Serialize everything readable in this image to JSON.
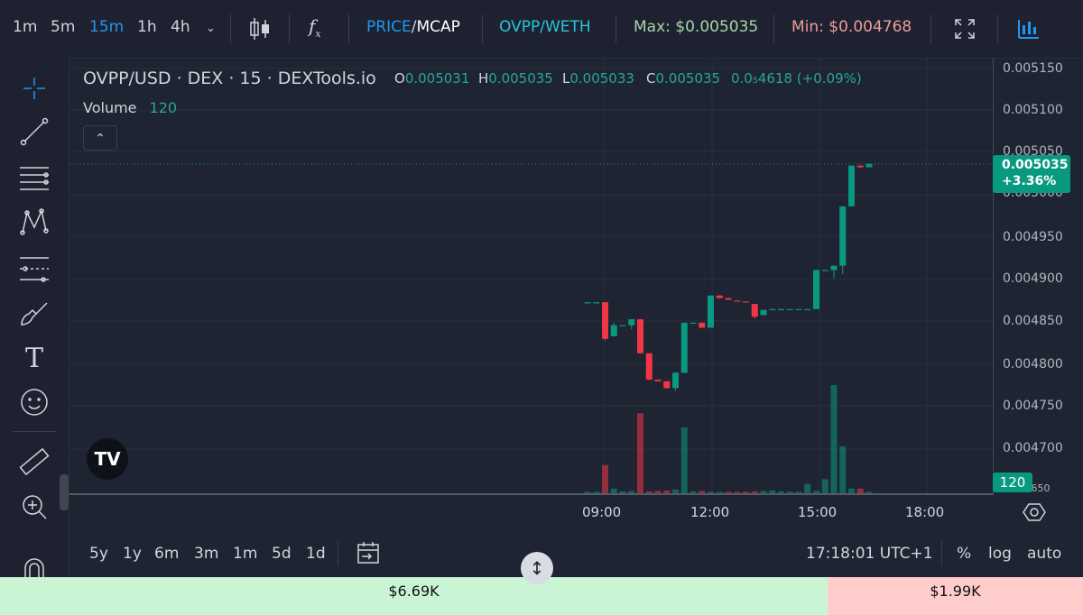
{
  "toolbar": {
    "intervals": [
      "1m",
      "5m",
      "15m",
      "1h",
      "4h"
    ],
    "active_interval": "15m",
    "price_mcap": {
      "first": "PRICE",
      "sep": "/",
      "second": "MCAP"
    },
    "pair": "OVPP/WETH",
    "max_label": "Max: $0.005035",
    "min_label": "Min: $0.004768"
  },
  "legend": {
    "title": "OVPP/USD · DEX · 15 · DEXTools.io",
    "open_key": "O",
    "open": "0.005031",
    "high_key": "H",
    "high": "0.005035",
    "low_key": "L",
    "low": "0.005033",
    "close_key": "C",
    "close": "0.005035",
    "change": "0.0₅4618 (+0.09%)",
    "volume_label": "Volume",
    "volume_value": "120"
  },
  "price_axis": [
    "0.005150",
    "0.005100",
    "0.005050",
    "0.005000",
    "0.004950",
    "0.004900",
    "0.004850",
    "0.004800",
    "0.004750",
    "0.004700",
    "0.004650"
  ],
  "current_price": {
    "price": "0.005035",
    "change": "+3.36%"
  },
  "volume_tag": "120",
  "time_axis": [
    "09:00",
    "12:00",
    "15:00",
    "18:00"
  ],
  "bottom": {
    "ranges": [
      "5y",
      "1y",
      "6m",
      "3m",
      "1m",
      "5d",
      "1d"
    ],
    "clock": "17:18:01 UTC+1",
    "percent": "%",
    "log": "log",
    "auto": "auto"
  },
  "buy_total": "$6.69K",
  "sell_total": "$1.99K",
  "logo_text": "TV",
  "colors": {
    "up": "#089981",
    "down": "#f23645",
    "accent": "#2196f3",
    "max": "#a5d6a7",
    "min": "#ef9a9a"
  },
  "chart_data": {
    "type": "candlestick",
    "interval": "15m",
    "candles": [
      {
        "t": "08:15",
        "o": 0.004872,
        "h": 0.004872,
        "l": 0.004872,
        "c": 0.004872
      },
      {
        "t": "08:30",
        "o": 0.004872,
        "h": 0.004872,
        "l": 0.004872,
        "c": 0.004872
      },
      {
        "t": "08:45",
        "o": 0.004872,
        "h": 0.004872,
        "l": 0.004827,
        "c": 0.004829
      },
      {
        "t": "09:00",
        "o": 0.004832,
        "h": 0.004848,
        "l": 0.004832,
        "c": 0.004845
      },
      {
        "t": "09:15",
        "o": 0.004845,
        "h": 0.004845,
        "l": 0.004845,
        "c": 0.004845
      },
      {
        "t": "09:30",
        "o": 0.004845,
        "h": 0.004852,
        "l": 0.00484,
        "c": 0.004852
      },
      {
        "t": "09:45",
        "o": 0.004852,
        "h": 0.004852,
        "l": 0.004812,
        "c": 0.004812
      },
      {
        "t": "10:00",
        "o": 0.004812,
        "h": 0.004812,
        "l": 0.00478,
        "c": 0.004781
      },
      {
        "t": "10:15",
        "o": 0.004781,
        "h": 0.004781,
        "l": 0.004779,
        "c": 0.004779
      },
      {
        "t": "10:30",
        "o": 0.004779,
        "h": 0.004779,
        "l": 0.00477,
        "c": 0.004771
      },
      {
        "t": "10:45",
        "o": 0.004771,
        "h": 0.00479,
        "l": 0.004768,
        "c": 0.004789
      },
      {
        "t": "11:00",
        "o": 0.004789,
        "h": 0.004848,
        "l": 0.004789,
        "c": 0.004848
      },
      {
        "t": "11:15",
        "o": 0.004848,
        "h": 0.004848,
        "l": 0.004848,
        "c": 0.004848
      },
      {
        "t": "11:30",
        "o": 0.004848,
        "h": 0.004848,
        "l": 0.004842,
        "c": 0.004842
      },
      {
        "t": "11:45",
        "o": 0.004842,
        "h": 0.00488,
        "l": 0.004842,
        "c": 0.00488
      },
      {
        "t": "12:00",
        "o": 0.00488,
        "h": 0.00488,
        "l": 0.004876,
        "c": 0.004877
      },
      {
        "t": "12:15",
        "o": 0.004877,
        "h": 0.004877,
        "l": 0.004875,
        "c": 0.004875
      },
      {
        "t": "12:30",
        "o": 0.004874,
        "h": 0.004874,
        "l": 0.004873,
        "c": 0.004873
      },
      {
        "t": "12:45",
        "o": 0.004873,
        "h": 0.004873,
        "l": 0.004872,
        "c": 0.004872
      },
      {
        "t": "13:00",
        "o": 0.00487,
        "h": 0.00487,
        "l": 0.004853,
        "c": 0.004855
      },
      {
        "t": "13:15",
        "o": 0.004857,
        "h": 0.004863,
        "l": 0.004857,
        "c": 0.004863
      },
      {
        "t": "13:30",
        "o": 0.004863,
        "h": 0.004864,
        "l": 0.004863,
        "c": 0.004864
      },
      {
        "t": "13:45",
        "o": 0.004864,
        "h": 0.004864,
        "l": 0.004864,
        "c": 0.004864
      },
      {
        "t": "14:00",
        "o": 0.004864,
        "h": 0.004864,
        "l": 0.004864,
        "c": 0.004864
      },
      {
        "t": "14:15",
        "o": 0.004864,
        "h": 0.004864,
        "l": 0.004864,
        "c": 0.004864
      },
      {
        "t": "14:30",
        "o": 0.004864,
        "h": 0.004864,
        "l": 0.004864,
        "c": 0.004864
      },
      {
        "t": "14:45",
        "o": 0.004864,
        "h": 0.00491,
        "l": 0.004864,
        "c": 0.00491
      },
      {
        "t": "15:00",
        "o": 0.00491,
        "h": 0.00491,
        "l": 0.00491,
        "c": 0.00491
      },
      {
        "t": "15:15",
        "o": 0.00491,
        "h": 0.004915,
        "l": 0.0049,
        "c": 0.004915
      },
      {
        "t": "15:30",
        "o": 0.004915,
        "h": 0.004985,
        "l": 0.004905,
        "c": 0.004985
      },
      {
        "t": "15:45",
        "o": 0.004985,
        "h": 0.005033,
        "l": 0.004985,
        "c": 0.005033
      },
      {
        "t": "16:00",
        "o": 0.005033,
        "h": 0.005033,
        "l": 0.00503,
        "c": 0.005031
      },
      {
        "t": "16:15",
        "o": 0.005031,
        "h": 0.005035,
        "l": 0.005031,
        "c": 0.005035
      }
    ],
    "volume": [
      3,
      3,
      60,
      10,
      4,
      5,
      170,
      4,
      5,
      6,
      8,
      140,
      4,
      5,
      3,
      2,
      3,
      2,
      3,
      4,
      5,
      6,
      4,
      3,
      3,
      20,
      5,
      30,
      230,
      100,
      10,
      10,
      3
    ],
    "volume_colors": [
      "up",
      "up",
      "down",
      "up",
      "up",
      "up",
      "down",
      "down",
      "down",
      "down",
      "up",
      "up",
      "up",
      "down",
      "up",
      "up",
      "down",
      "down",
      "down",
      "down",
      "up",
      "up",
      "up",
      "up",
      "up",
      "up",
      "up",
      "up",
      "up",
      "up",
      "up",
      "down",
      "up"
    ],
    "ylim": [
      0.004645,
      0.00516
    ],
    "volume_max": 230,
    "grid": true
  }
}
